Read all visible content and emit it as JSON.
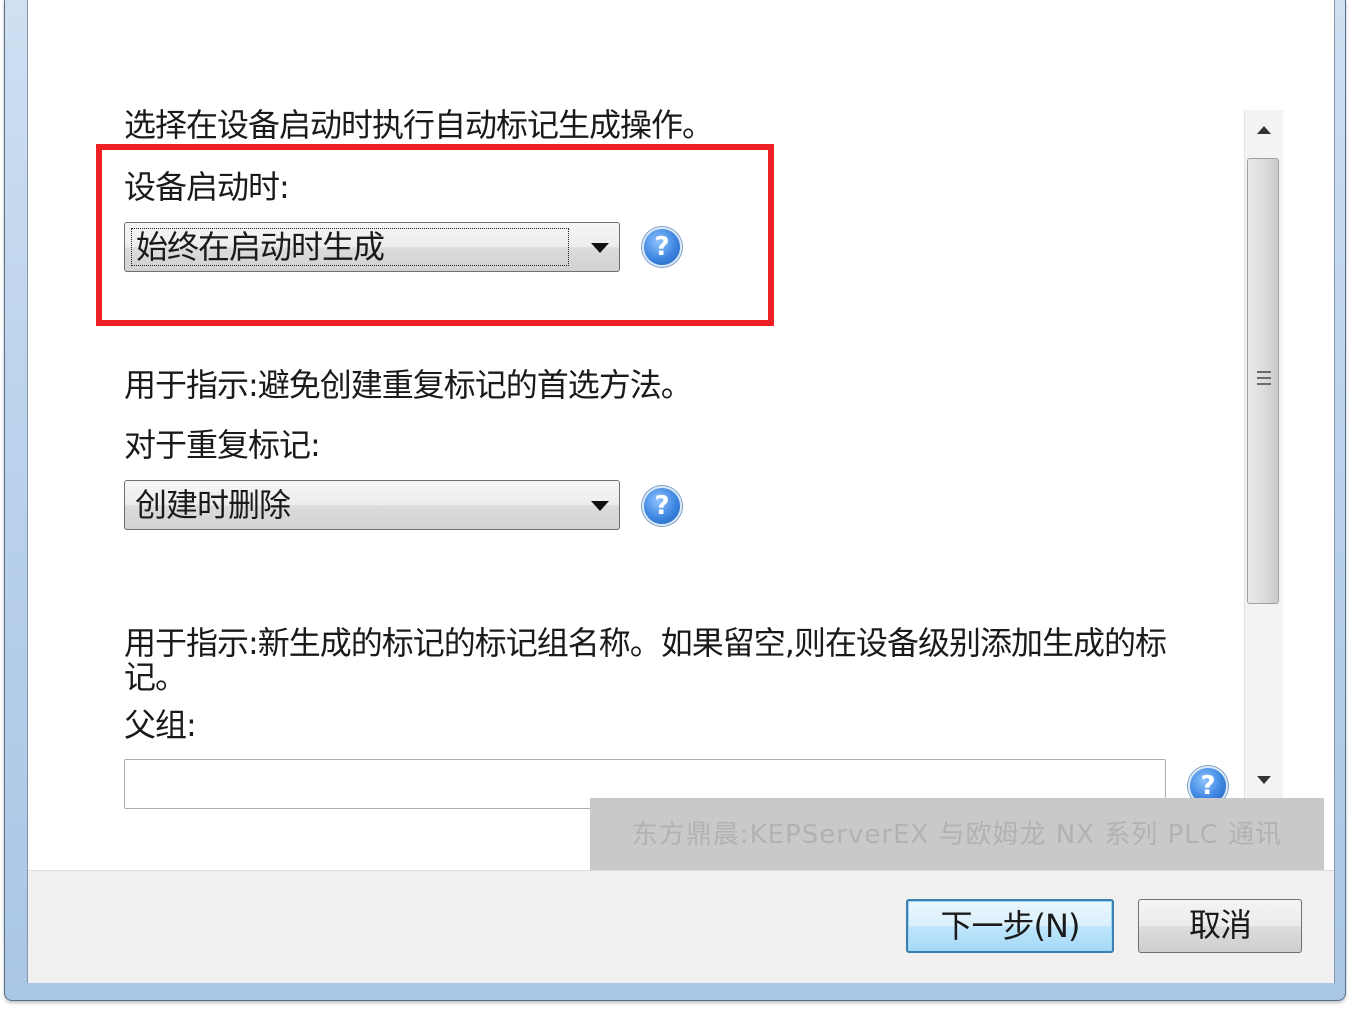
{
  "section1": {
    "description": "选择在设备启动时执行自动标记生成操作。",
    "label": "设备启动时:",
    "value": "始终在启动时生成"
  },
  "section2": {
    "description": "用于指示:避免创建重复标记的首选方法。",
    "label": "对于重复标记:",
    "value": "创建时删除"
  },
  "section3": {
    "description": "用于指示:新生成的标记的标记组名称。如果留空,则在设备级别添加生成的标记。",
    "label": "父组:",
    "value": ""
  },
  "help_glyph": "?",
  "watermark": "东方鼎晨:KEPServerEX 与欧姆龙 NX 系列 PLC 通讯",
  "buttons": {
    "next": "下一步(N)",
    "cancel": "取消"
  },
  "colors": {
    "highlight": "#ee2224",
    "help_icon": "#3d86e0"
  }
}
